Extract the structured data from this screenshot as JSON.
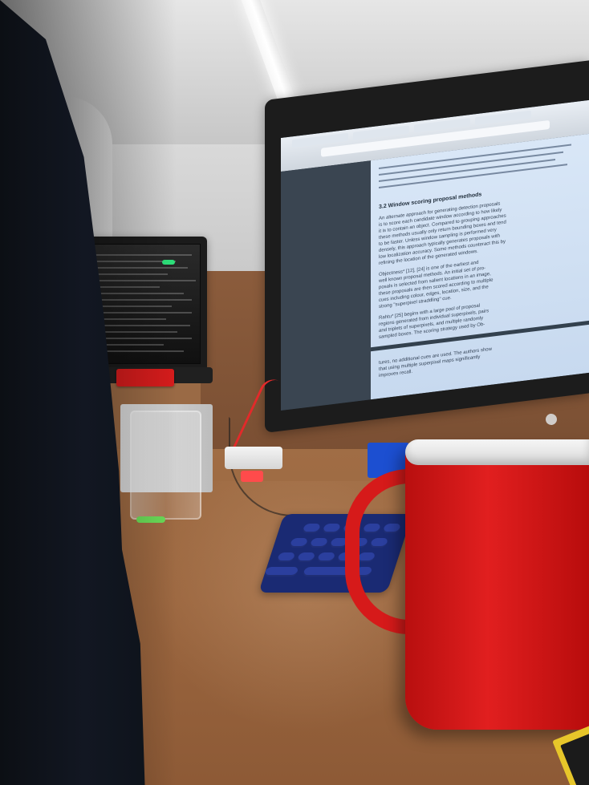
{
  "colors": {
    "accent_red": "#e11f1f",
    "keyboard_blue": "#1a2a73",
    "screen_page_blue": "#d9e7f7",
    "desk_wood": "#9b663f"
  },
  "monitor": {
    "section_heading": "3.2   Window scoring proposal methods",
    "page_lines": [
      "An alternate approach for generating detection proposals",
      "is to score each candidate window according to how likely",
      "it is to contain an object. Compared to grouping approaches",
      "these methods usually only return bounding boxes and tend",
      "to be faster. Unless window sampling is performed very",
      "densely, this approach typically generates proposals with",
      "low localization accuracy. Some methods counteract this by",
      "refining the location of the generated windows.",
      "Objectness* [12], [24] is one of the earliest and",
      "well known proposal methods. An initial set of pro-",
      "posals is selected from salient locations in an image,",
      "these proposals are then scored according to multiple",
      "cues including colour, edges, location, size, and the",
      "strong \"superpixel straddling\" cue.",
      "Rahtu* [25] begins with a large pool of proposal",
      "regions generated from individual superpixels, pairs",
      "and triplets of superpixels, and multiple randomly",
      "sampled boxes. The scoring strategy used by Ob-"
    ],
    "bottom_lines": [
      "tures, no additional cues are used. The authors show",
      "that using multiple superpixel maps significantly",
      "improves recall."
    ]
  }
}
